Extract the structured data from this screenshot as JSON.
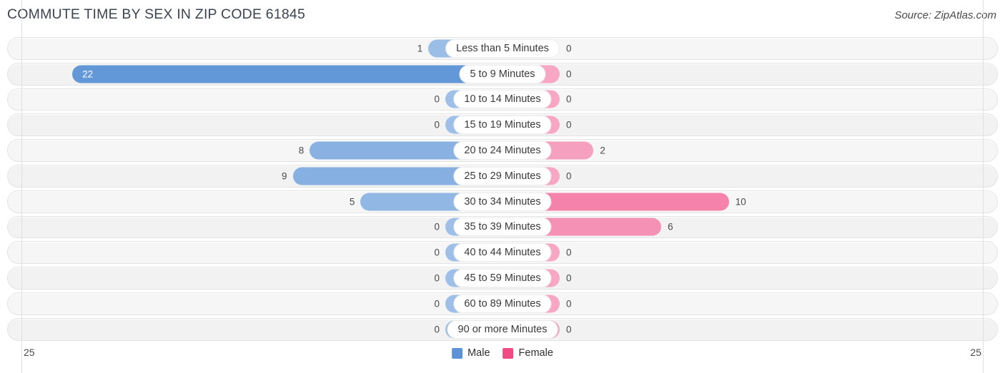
{
  "header": {
    "title": "COMMUTE TIME BY SEX IN ZIP CODE 61845",
    "source": "Source: ZipAtlas.com"
  },
  "axis": {
    "left_cap": "25",
    "right_cap": "25",
    "max": 25
  },
  "legend": {
    "male_label": "Male",
    "female_label": "Female",
    "male_color": "#5b93d6",
    "female_color": "#f04b84"
  },
  "chart_data": {
    "type": "bar",
    "title": "COMMUTE TIME BY SEX IN ZIP CODE 61845",
    "xlabel": "",
    "ylabel": "",
    "orientation": "horizontal-diverging",
    "xlim": [
      25,
      25
    ],
    "grid": false,
    "legend_position": "bottom-center",
    "categories": [
      "Less than 5 Minutes",
      "5 to 9 Minutes",
      "10 to 14 Minutes",
      "15 to 19 Minutes",
      "20 to 24 Minutes",
      "25 to 29 Minutes",
      "30 to 34 Minutes",
      "35 to 39 Minutes",
      "40 to 44 Minutes",
      "45 to 59 Minutes",
      "60 to 89 Minutes",
      "90 or more Minutes"
    ],
    "series": [
      {
        "name": "Male",
        "direction": "left",
        "values": [
          1,
          22,
          0,
          0,
          8,
          9,
          5,
          0,
          0,
          0,
          0,
          0
        ]
      },
      {
        "name": "Female",
        "direction": "right",
        "values": [
          0,
          0,
          0,
          0,
          2,
          0,
          10,
          6,
          0,
          0,
          0,
          0
        ]
      }
    ]
  }
}
